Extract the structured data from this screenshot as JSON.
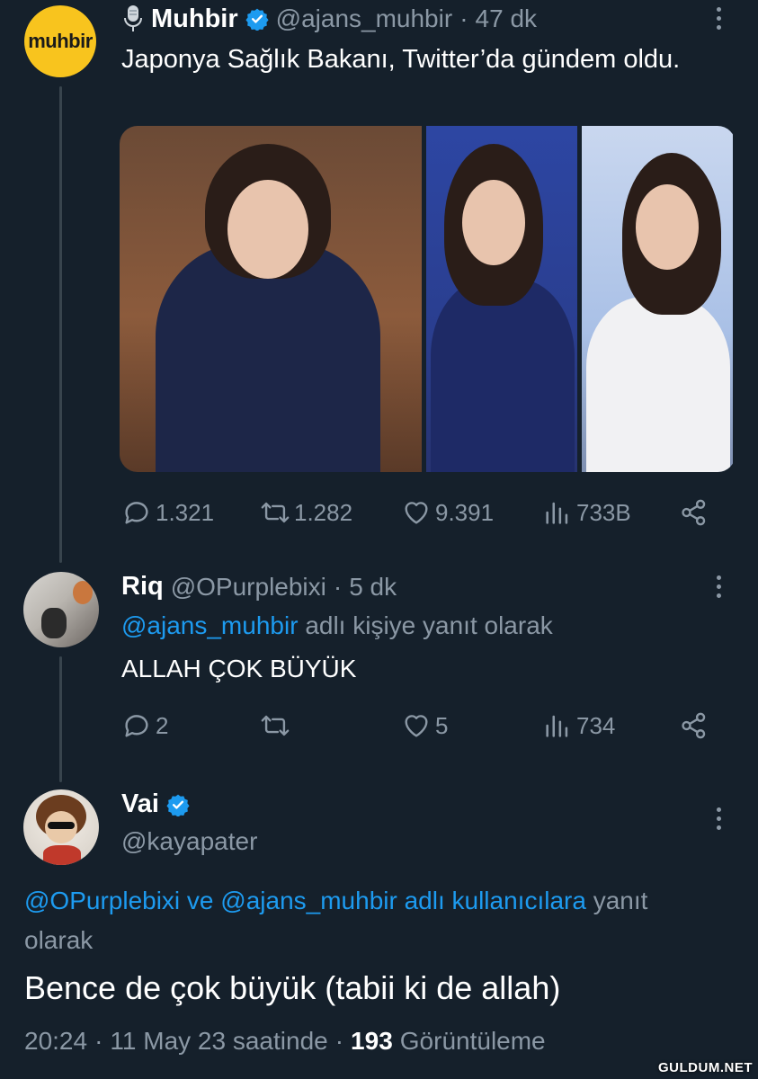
{
  "tweet1": {
    "avatar_text": "muhbir",
    "name": "Muhbir",
    "handle": "@ajans_muhbir",
    "separator": "·",
    "time": "47 dk",
    "text": "Japonya Sağlık Bakanı, Twitter’da gündem oldu.",
    "stats": {
      "replies": "1.321",
      "retweets": "1.282",
      "likes": "9.391",
      "views": "733B"
    }
  },
  "tweet2": {
    "name": "Riq",
    "handle": "@OPurplebixi",
    "separator": "·",
    "time": "5 dk",
    "reply_handle": "@ajans_muhbir",
    "reply_suffix": "adlı kişiye yanıt olarak",
    "text": "ALLAH ÇOK BÜYÜK",
    "stats": {
      "replies": "2",
      "retweets": "",
      "likes": "5",
      "views": "734"
    }
  },
  "tweet3": {
    "name": "Vai",
    "handle": "@kayapater",
    "reply_line1": "@OPurplebixi ve @ajans_muhbir adlı kullanıcılara",
    "reply_line1_suffix": "yanıt",
    "reply_line2": "olarak",
    "text": "Bence de çok büyük (tabii ki de allah)",
    "time": "20:24",
    "dot": "·",
    "date": "11 May 23 saatinde",
    "dot2": "·",
    "views_count": "193",
    "views_label": "Görüntüleme"
  },
  "watermark": "GULDUM.NET",
  "colors": {
    "background": "#15202b",
    "muted": "#8b98a5",
    "link": "#1d9bf0",
    "verified": "#1d9bf0",
    "avatar_muhbir": "#f8c41e"
  }
}
